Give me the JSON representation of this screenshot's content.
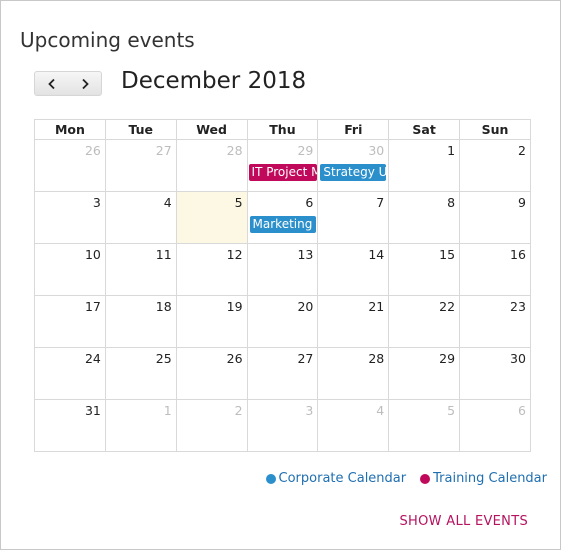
{
  "widget": {
    "title": "Upcoming events"
  },
  "calendar": {
    "month_label": "December 2018",
    "prev_label": "‹",
    "next_label": "›",
    "weekdays": [
      "Mon",
      "Tue",
      "Wed",
      "Thu",
      "Fri",
      "Sat",
      "Sun"
    ],
    "weeks": [
      [
        {
          "day": "26",
          "other": true
        },
        {
          "day": "27",
          "other": true
        },
        {
          "day": "28",
          "other": true
        },
        {
          "day": "29",
          "other": true,
          "event": {
            "title": "IT Project M",
            "calendar": "training"
          }
        },
        {
          "day": "30",
          "other": true,
          "event": {
            "title": "Strategy U",
            "calendar": "corporate"
          }
        },
        {
          "day": "1",
          "other": false
        },
        {
          "day": "2",
          "other": false
        }
      ],
      [
        {
          "day": "3",
          "other": false
        },
        {
          "day": "4",
          "other": false
        },
        {
          "day": "5",
          "other": false,
          "today": true
        },
        {
          "day": "6",
          "other": false,
          "event": {
            "title": "Marketing",
            "calendar": "corporate"
          }
        },
        {
          "day": "7",
          "other": false
        },
        {
          "day": "8",
          "other": false
        },
        {
          "day": "9",
          "other": false
        }
      ],
      [
        {
          "day": "10",
          "other": false
        },
        {
          "day": "11",
          "other": false
        },
        {
          "day": "12",
          "other": false
        },
        {
          "day": "13",
          "other": false
        },
        {
          "day": "14",
          "other": false
        },
        {
          "day": "15",
          "other": false
        },
        {
          "day": "16",
          "other": false
        }
      ],
      [
        {
          "day": "17",
          "other": false
        },
        {
          "day": "18",
          "other": false
        },
        {
          "day": "19",
          "other": false
        },
        {
          "day": "20",
          "other": false
        },
        {
          "day": "21",
          "other": false
        },
        {
          "day": "22",
          "other": false
        },
        {
          "day": "23",
          "other": false
        }
      ],
      [
        {
          "day": "24",
          "other": false
        },
        {
          "day": "25",
          "other": false
        },
        {
          "day": "26",
          "other": false
        },
        {
          "day": "27",
          "other": false
        },
        {
          "day": "28",
          "other": false
        },
        {
          "day": "29",
          "other": false
        },
        {
          "day": "30",
          "other": false
        }
      ],
      [
        {
          "day": "31",
          "other": false
        },
        {
          "day": "1",
          "other": true
        },
        {
          "day": "2",
          "other": true
        },
        {
          "day": "3",
          "other": true
        },
        {
          "day": "4",
          "other": true
        },
        {
          "day": "5",
          "other": true
        },
        {
          "day": "6",
          "other": true
        }
      ]
    ]
  },
  "legend": {
    "items": [
      {
        "label": "Corporate Calendar",
        "color": "#2a8fcb",
        "icon": "dot-icon"
      },
      {
        "label": "Training Calendar",
        "color": "#c0095b",
        "icon": "dot-icon"
      }
    ],
    "link_color": "#1f6fb0"
  },
  "footer": {
    "show_all_label": "SHOW ALL EVENTS",
    "show_all_color": "#b5135f"
  },
  "colors": {
    "today_bg": "#fcf8e3",
    "training": "#c0095b",
    "corporate": "#2a8fcb"
  }
}
